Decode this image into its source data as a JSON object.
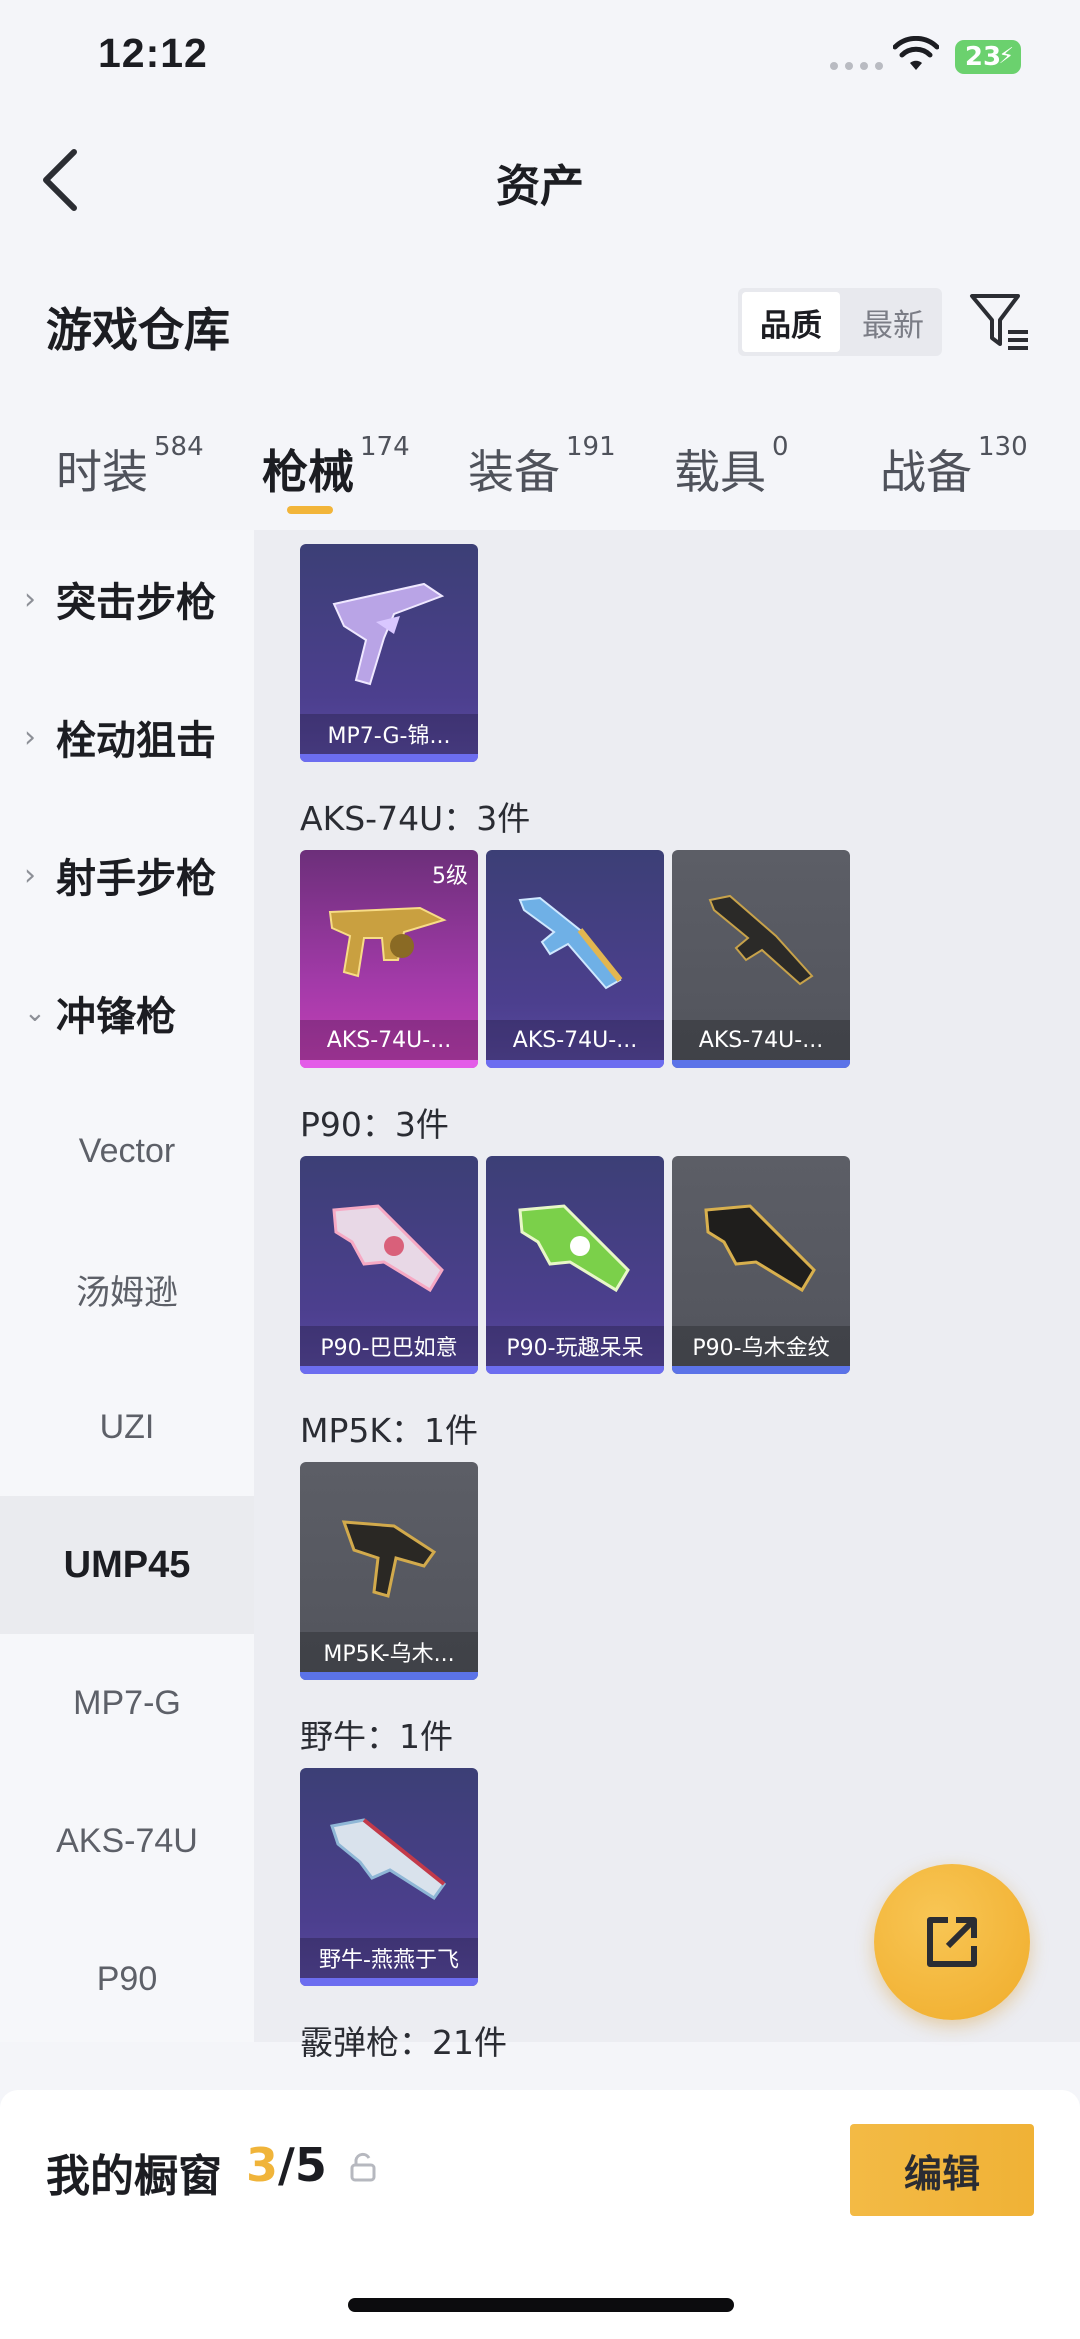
{
  "status_bar": {
    "time": "12:12",
    "battery": "23"
  },
  "header": {
    "title": "资产"
  },
  "warehouse": {
    "title": "游戏仓库",
    "sort_options": [
      "品质",
      "最新"
    ],
    "sort_selected": "品质"
  },
  "category_tabs": [
    {
      "label": "时装",
      "count": "584"
    },
    {
      "label": "枪械",
      "count": "174",
      "active": true
    },
    {
      "label": "装备",
      "count": "191"
    },
    {
      "label": "载具",
      "count": "0"
    },
    {
      "label": "战备",
      "count": "130"
    }
  ],
  "sidebar": {
    "groups": [
      {
        "label": "突击步枪",
        "expanded": false
      },
      {
        "label": "栓动狙击",
        "expanded": false
      },
      {
        "label": "射手步枪",
        "expanded": false
      },
      {
        "label": "冲锋枪",
        "expanded": true
      }
    ],
    "subitems": [
      "Vector",
      "汤姆逊",
      "UZI",
      "UMP45",
      "MP7-G",
      "AKS-74U",
      "P90"
    ],
    "active_subitem": "UMP45"
  },
  "content": {
    "sections": [
      {
        "title": "",
        "items": [
          {
            "name": "MP7-G-锦...",
            "rarity": "purple"
          }
        ]
      },
      {
        "title": "AKS-74U：3件",
        "items": [
          {
            "name": "AKS-74U-...",
            "rarity": "pink",
            "badge": "5级"
          },
          {
            "name": "AKS-74U-...",
            "rarity": "purple"
          },
          {
            "name": "AKS-74U-...",
            "rarity": "grey"
          }
        ]
      },
      {
        "title": "P90：3件",
        "items": [
          {
            "name": "P90-巴巴如意",
            "rarity": "purple"
          },
          {
            "name": "P90-玩趣呆呆",
            "rarity": "purple"
          },
          {
            "name": "P90-乌木金纹",
            "rarity": "grey"
          }
        ]
      },
      {
        "title": "MP5K：1件",
        "items": [
          {
            "name": "MP5K-乌木...",
            "rarity": "grey"
          }
        ]
      },
      {
        "title": "野牛：1件",
        "items": [
          {
            "name": "野牛-燕燕于飞",
            "rarity": "purple"
          }
        ]
      },
      {
        "title": "霰弹枪：21件",
        "items": []
      }
    ]
  },
  "showcase": {
    "label": "我的橱窗",
    "current": "3",
    "total": "/5",
    "edit_label": "编辑"
  },
  "colors": {
    "accent": "#f2b53a",
    "rarity_purple": "#6c6df0",
    "rarity_pink": "#e35de8",
    "rarity_grey": "#5b73e8"
  },
  "icons": [
    "back-arrow-icon",
    "filter-icon",
    "share-icon",
    "lock-icon",
    "wifi-icon"
  ]
}
